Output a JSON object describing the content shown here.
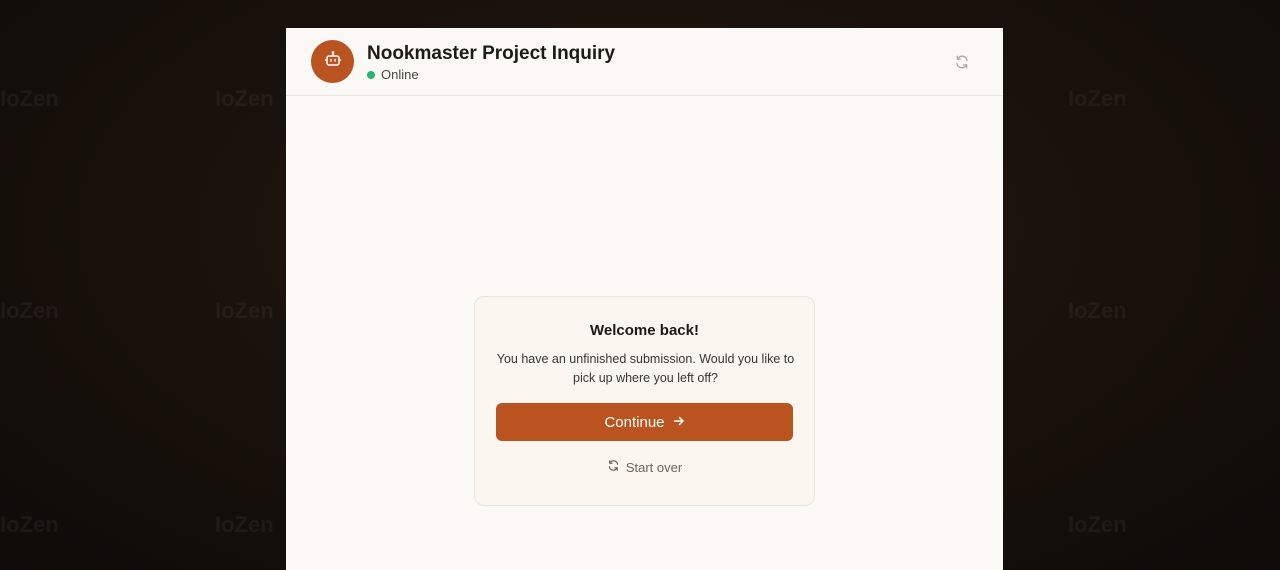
{
  "watermark": "IoZen",
  "header": {
    "title": "Nookmaster Project Inquiry",
    "status": "Online",
    "icons": {
      "avatar": "robot-icon",
      "refresh": "refresh-icon"
    }
  },
  "card": {
    "title": "Welcome back!",
    "message": "You have an unfinished submission. Would you like to pick up where you left off?",
    "continue_label": "Continue",
    "start_over_label": "Start over"
  },
  "colors": {
    "accent": "#b9531f",
    "status_online": "#22b573",
    "panel_bg": "#fcfaf7",
    "backdrop": "#1a120c"
  }
}
